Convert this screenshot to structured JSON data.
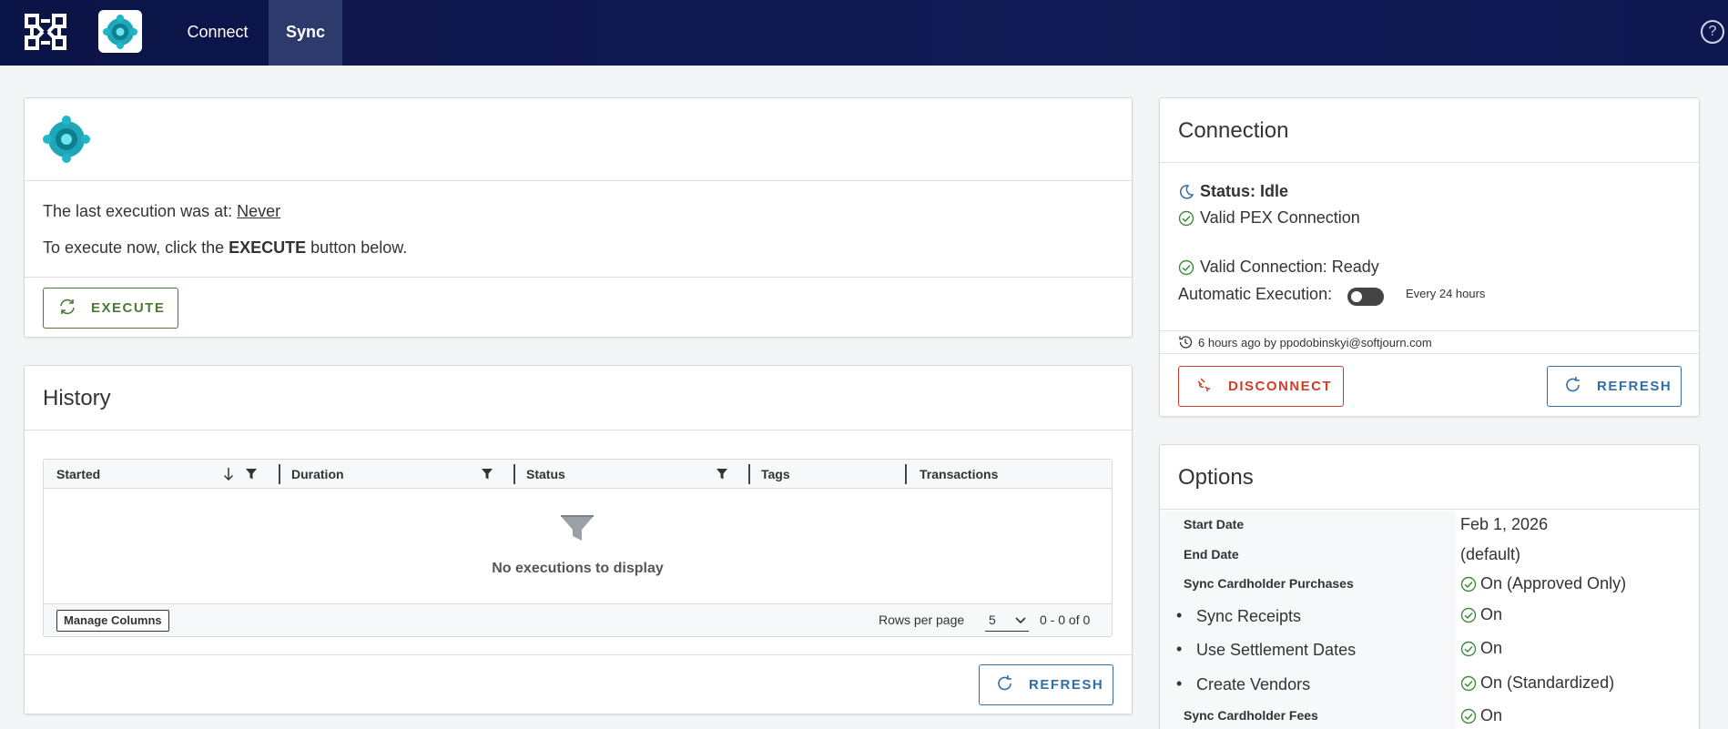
{
  "nav": {
    "tabs": [
      {
        "label": "Connect"
      },
      {
        "label": "Sync"
      }
    ],
    "help_label": "?"
  },
  "execution": {
    "last_prefix": "The last execution was at:",
    "last_value": "Never",
    "instr_prefix": "To execute now, click the",
    "instr_bold": "EXECUTE",
    "instr_suffix": "button below.",
    "execute_label": "EXECUTE"
  },
  "history": {
    "title": "History",
    "columns": [
      "Started",
      "Duration",
      "Status",
      "Tags",
      "Transactions"
    ],
    "empty_text": "No executions to display",
    "manage_columns_label": "Manage Columns",
    "rows_per_page_label": "Rows per page",
    "rows_per_page_value": "5",
    "range_text": "0 - 0 of 0",
    "refresh_label": "REFRESH"
  },
  "connection": {
    "title": "Connection",
    "status_text": "Status: Idle",
    "valid_pex": "Valid PEX Connection",
    "valid_conn": "Valid Connection: Ready",
    "auto_exec_label": "Automatic Execution:",
    "auto_exec_on": false,
    "every_text": "Every 24 hours",
    "last_sync_text": "6 hours ago by ppodobinskyi@softjourn.com",
    "disconnect_label": "DISCONNECT",
    "refresh_label": "REFRESH"
  },
  "options": {
    "title": "Options",
    "rows": [
      {
        "key": "Start Date",
        "value": "Feb 1, 2026"
      },
      {
        "key": "End Date",
        "value": "(default)"
      },
      {
        "key": "Sync Cardholder Purchases",
        "value": "On (Approved Only)"
      },
      {
        "key": "Sync Receipts",
        "value": "On"
      },
      {
        "key": "Use Settlement Dates",
        "value": "On"
      },
      {
        "key": "Create Vendors",
        "value": "On (Standardized)"
      },
      {
        "key": "Sync Cardholder Fees",
        "value": "On"
      }
    ]
  },
  "colors": {
    "nav_bg": "#0b1446",
    "execute_green": "#4c7a34",
    "refresh_blue": "#2f6fa6",
    "disconnect_red": "#d23c2a",
    "check_green": "#3d8a3a",
    "logo_teal": "#1fa6b8"
  },
  "icons": {
    "app_launcher": "app-launcher-grid-icon",
    "app_logo": "business-central-logo-icon",
    "sync": "sync-icon",
    "refresh": "refresh-icon",
    "filter": "filter-icon",
    "sort": "sort-down-icon",
    "moon": "moon-icon",
    "check": "check-circle-icon",
    "history": "history-icon",
    "disconnect": "unplug-icon",
    "chevron": "chevron-down-icon",
    "help": "help-icon"
  }
}
